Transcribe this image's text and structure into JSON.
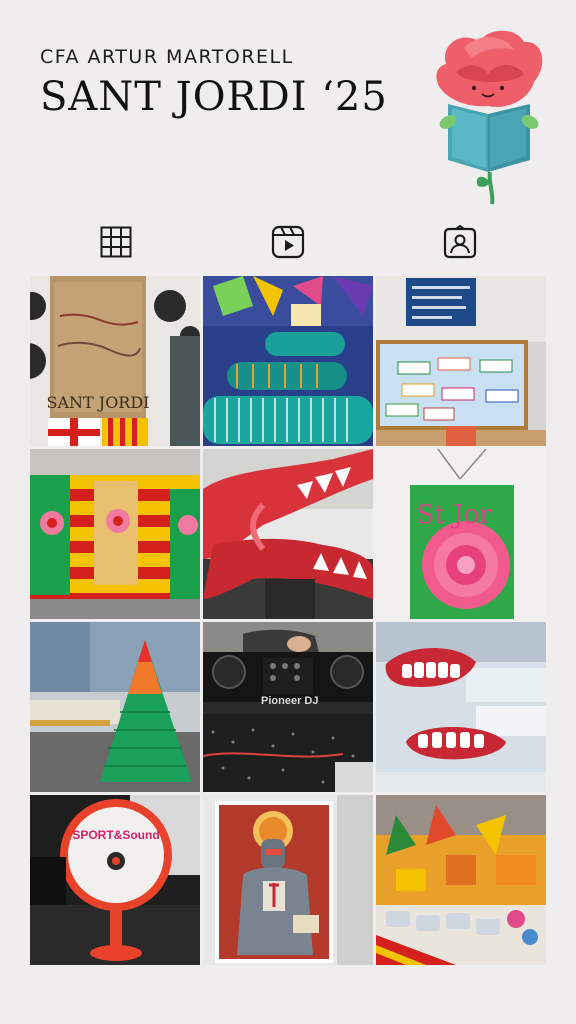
{
  "header": {
    "subtitle": "CFA ARTUR MARTORELL",
    "title": "SANT JORDI ‘25"
  },
  "mascot": {
    "icon": "rose-reading-book-icon"
  },
  "tabs": [
    {
      "icon": "grid-icon",
      "active": true
    },
    {
      "icon": "reels-icon",
      "active": false
    },
    {
      "icon": "tagged-person-icon",
      "active": false
    }
  ],
  "posts": [
    {
      "id": "post-1",
      "caption": "SANT JORDI"
    },
    {
      "id": "post-2",
      "caption": ""
    },
    {
      "id": "post-3",
      "caption": ""
    },
    {
      "id": "post-4",
      "caption": ""
    },
    {
      "id": "post-5",
      "caption": ""
    },
    {
      "id": "post-6",
      "caption": "St Jor"
    },
    {
      "id": "post-7",
      "caption": ""
    },
    {
      "id": "post-8",
      "caption": "Pioneer DJ"
    },
    {
      "id": "post-9",
      "caption": ""
    },
    {
      "id": "post-10",
      "caption": "SPORT&Sound"
    },
    {
      "id": "post-11",
      "caption": ""
    },
    {
      "id": "post-12",
      "caption": ""
    }
  ],
  "colors": {
    "background": "#efedee",
    "catalan_yellow": "#f4c300",
    "catalan_red": "#d6201b",
    "rose_pink": "#f06a78",
    "book_teal": "#4aa5b5"
  }
}
